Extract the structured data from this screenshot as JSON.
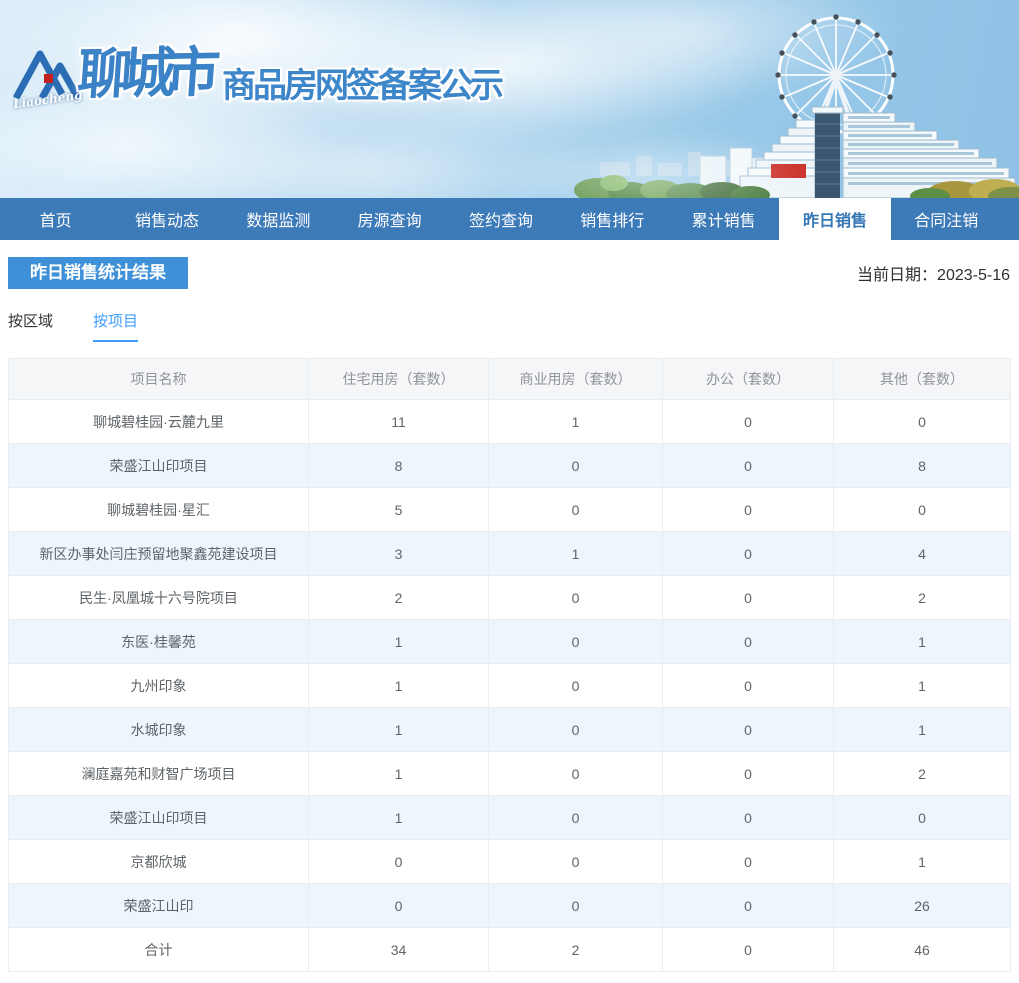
{
  "banner": {
    "logo_script": "Liaocheng",
    "brand": "聊城市",
    "site_title": "商品房网签备案公示"
  },
  "nav": {
    "items": [
      {
        "label": "首页",
        "active": false
      },
      {
        "label": "销售动态",
        "active": false
      },
      {
        "label": "数据监测",
        "active": false
      },
      {
        "label": "房源查询",
        "active": false
      },
      {
        "label": "签约查询",
        "active": false
      },
      {
        "label": "销售排行",
        "active": false
      },
      {
        "label": "累计销售",
        "active": false
      },
      {
        "label": "昨日销售",
        "active": true
      },
      {
        "label": "合同注销",
        "active": false
      }
    ]
  },
  "page": {
    "section_title": "昨日销售统计结果",
    "date_label": "当前日期：",
    "date_value": "2023-5-16"
  },
  "tabs": [
    {
      "label": "按区域",
      "active": false
    },
    {
      "label": "按项目",
      "active": true
    }
  ],
  "table": {
    "columns": [
      "项目名称",
      "住宅用房（套数）",
      "商业用房（套数）",
      "办公（套数）",
      "其他（套数）"
    ],
    "rows": [
      [
        "聊城碧桂园·云麓九里",
        "11",
        "1",
        "0",
        "0"
      ],
      [
        "荣盛江山印项目",
        "8",
        "0",
        "0",
        "8"
      ],
      [
        "聊城碧桂园·星汇",
        "5",
        "0",
        "0",
        "0"
      ],
      [
        "新区办事处闫庄预留地聚鑫苑建设项目",
        "3",
        "1",
        "0",
        "4"
      ],
      [
        "民生·凤凰城十六号院项目",
        "2",
        "0",
        "0",
        "2"
      ],
      [
        "东医·桂馨苑",
        "1",
        "0",
        "0",
        "1"
      ],
      [
        "九州印象",
        "1",
        "0",
        "0",
        "1"
      ],
      [
        "水城印象",
        "1",
        "0",
        "0",
        "1"
      ],
      [
        "澜庭嘉苑和财智广场项目",
        "1",
        "0",
        "0",
        "2"
      ],
      [
        "荣盛江山印项目",
        "1",
        "0",
        "0",
        "0"
      ],
      [
        "京都欣城",
        "0",
        "0",
        "0",
        "1"
      ],
      [
        "荣盛江山印",
        "0",
        "0",
        "0",
        "26"
      ],
      [
        "合计",
        "34",
        "2",
        "0",
        "46"
      ]
    ]
  }
}
